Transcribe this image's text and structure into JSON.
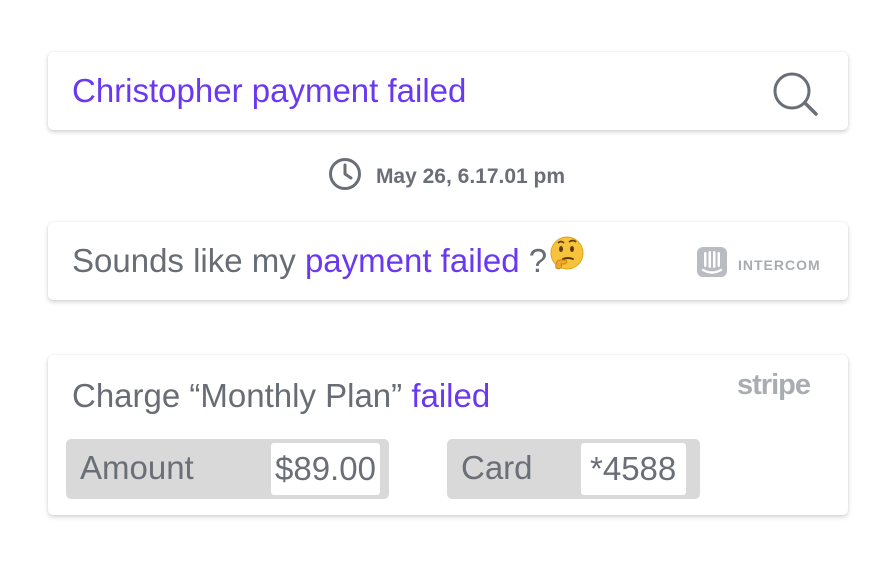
{
  "search": {
    "query": "Christopher payment failed",
    "icon": "search-icon"
  },
  "timestamp": {
    "icon": "clock-icon",
    "text": "May 26, 6.17.01 pm"
  },
  "message": {
    "prefix": "Sounds like my ",
    "highlight": "payment failed",
    "suffix": " ?",
    "emoji": "thinking-face",
    "source_icon": "intercom-icon",
    "source_label": "INTERCOM"
  },
  "charge": {
    "title_prefix": "Charge “Monthly Plan” ",
    "title_status": "failed",
    "source_label": "stripe",
    "amount_label": "Amount",
    "amount_value": "$89.00",
    "card_label": "Card",
    "card_value": "*4588"
  },
  "colors": {
    "accent": "#6a38f2",
    "text": "#686c74",
    "muted": "#a8abb0",
    "field_bg": "#d9d9d9"
  }
}
